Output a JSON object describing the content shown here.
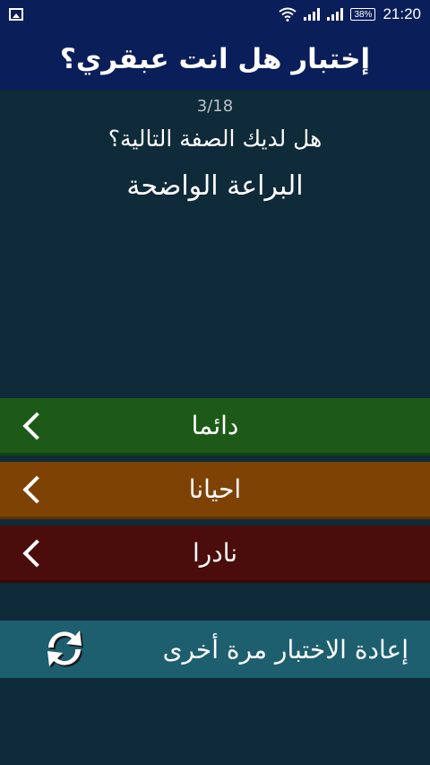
{
  "status": {
    "battery": "38%",
    "time": "21:20",
    "icons": [
      "gallery-icon",
      "wifi-icon",
      "signal-icon",
      "signal-icon"
    ]
  },
  "header": {
    "title": "إختبار هل انت عبقري؟"
  },
  "quiz": {
    "counter": "3/18",
    "question": "هل لديك الصفة التالية؟",
    "trait": "البراعة الواضحة"
  },
  "answers": [
    {
      "label": "دائما",
      "color": "#1e5a17"
    },
    {
      "label": "احيانا",
      "color": "#7e4304"
    },
    {
      "label": "نادرا",
      "color": "#4b0c0c"
    }
  ],
  "retry": {
    "label": "إعادة الاختبار مرة أخرى",
    "icon": "refresh-icon",
    "color": "#1d5f6f"
  },
  "colors": {
    "background": "#0f2a38",
    "header": "#0a1e5a"
  }
}
